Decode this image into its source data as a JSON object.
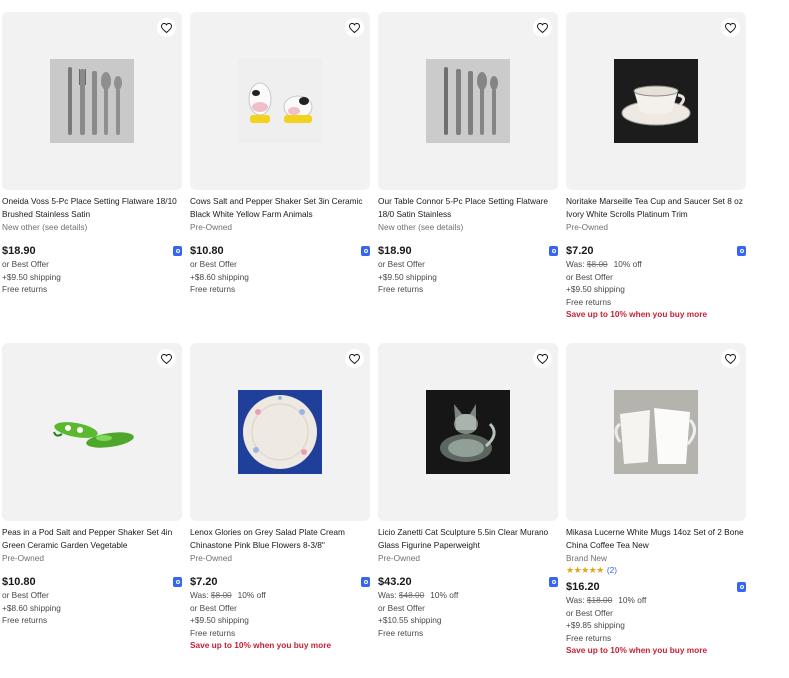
{
  "items": [
    {
      "title": "Oneida Voss 5-Pc Place Setting Flatware 18/10 Brushed Stainless Satin",
      "condition": "New other (see details)",
      "price": "$18.90",
      "best_offer": "or Best Offer",
      "shipping": "+$9.50 shipping",
      "returns": "Free returns",
      "image": "flatware-icon"
    },
    {
      "title": "Cows Salt and Pepper Shaker Set 3in Ceramic Black White Yellow Farm Animals",
      "condition": "Pre-Owned",
      "price": "$10.80",
      "best_offer": "or Best Offer",
      "shipping": "+$8.60 shipping",
      "returns": "Free returns",
      "image": "cow-shakers-icon"
    },
    {
      "title": "Our Table Connor 5-Pc Place Setting Flatware 18/0 Satin Stainless",
      "condition": "New other (see details)",
      "price": "$18.90",
      "best_offer": "or Best Offer",
      "shipping": "+$9.50 shipping",
      "returns": "Free returns",
      "image": "flatware-icon"
    },
    {
      "title": "Noritake Marseille Tea Cup and Saucer Set 8 oz Ivory White Scrolls Platinum Trim",
      "condition": "Pre-Owned",
      "price": "$7.20",
      "was_label": "Was:",
      "was_price": "$8.00",
      "discount": "10% off",
      "best_offer": "or Best Offer",
      "shipping": "+$9.50 shipping",
      "returns": "Free returns",
      "promo": "Save up to 10% when you buy more",
      "image": "teacup-icon"
    },
    {
      "title": "Peas in a Pod Salt and Pepper Shaker Set 4in Green Ceramic Garden Vegetable",
      "condition": "Pre-Owned",
      "price": "$10.80",
      "best_offer": "or Best Offer",
      "shipping": "+$8.60 shipping",
      "returns": "Free returns",
      "image": "pea-pod-icon"
    },
    {
      "title": "Lenox Glories on Grey Salad Plate Cream Chinastone Pink Blue Flowers 8-3/8\"",
      "condition": "Pre-Owned",
      "price": "$7.20",
      "was_label": "Was:",
      "was_price": "$8.00",
      "discount": "10% off",
      "best_offer": "or Best Offer",
      "shipping": "+$9.50 shipping",
      "returns": "Free returns",
      "promo": "Save up to 10% when you buy more",
      "image": "plate-icon"
    },
    {
      "title": "Licio Zanetti Cat Sculpture 5.5in Clear Murano Glass Figurine Paperweight",
      "condition": "Pre-Owned",
      "price": "$43.20",
      "was_label": "Was:",
      "was_price": "$48.00",
      "discount": "10% off",
      "best_offer": "or Best Offer",
      "shipping": "+$10.55 shipping",
      "returns": "Free returns",
      "image": "glass-cat-icon"
    },
    {
      "title": "Mikasa Lucerne White Mugs 14oz Set of 2 Bone China Coffee Tea New",
      "condition": "Brand New",
      "stars": "★★★★★",
      "rating_count": "(2)",
      "price": "$16.20",
      "was_label": "Was:",
      "was_price": "$18.00",
      "discount": "10% off",
      "best_offer": "or Best Offer",
      "shipping": "+$9.85 shipping",
      "returns": "Free returns",
      "promo": "Save up to 10% when you buy more",
      "image": "mugs-icon"
    }
  ]
}
